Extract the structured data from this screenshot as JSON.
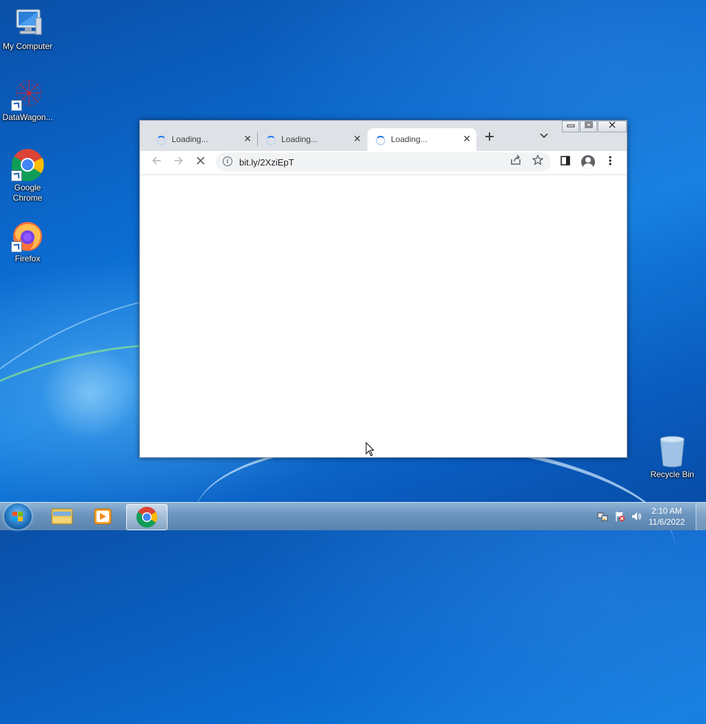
{
  "desktop": {
    "icons": [
      {
        "label": "My Computer"
      },
      {
        "label": "DataWagon..."
      },
      {
        "label": "Google Chrome"
      },
      {
        "label": "Firefox"
      },
      {
        "label": "Recycle Bin"
      }
    ]
  },
  "browser": {
    "tabs": [
      {
        "label": "Loading...",
        "active": false
      },
      {
        "label": "Loading...",
        "active": false
      },
      {
        "label": "Loading...",
        "active": true
      }
    ],
    "new_tab_icon": "plus-icon",
    "tab_search_icon": "chevron-down-icon",
    "omnibox": {
      "url": "bit.ly/2XziEpT",
      "info_icon": "i"
    },
    "toolbar_icons": [
      "back-arrow-icon",
      "forward-arrow-icon",
      "stop-icon",
      "share-icon",
      "star-icon",
      "side-panel-icon",
      "profile-icon",
      "kebab-menu-icon"
    ],
    "accent_color": "#1a73e8"
  },
  "taskbar": {
    "clock": {
      "time": "2:10 AM",
      "date": "11/6/2022"
    },
    "pinned": [
      "windows-explorer-icon",
      "media-player-icon",
      "chrome-icon"
    ]
  }
}
